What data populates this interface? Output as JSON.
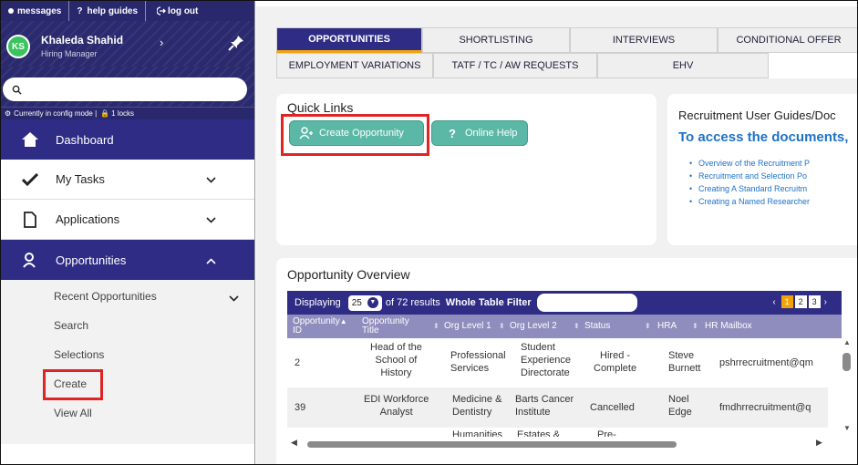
{
  "topbar": {
    "messages": "messages",
    "help": "help guides",
    "logout": "log out"
  },
  "user": {
    "initials": "KS",
    "name": "Khaleda Shahid",
    "role": "Hiring Manager"
  },
  "search": {
    "placeholder": ""
  },
  "config": {
    "text": "Currently in config mode |",
    "locks": "1 locks"
  },
  "nav": {
    "dashboard": "Dashboard",
    "tasks": "My Tasks",
    "applications": "Applications",
    "opportunities": "Opportunities",
    "sub": {
      "recent": "Recent Opportunities",
      "search": "Search",
      "selections": "Selections",
      "create": "Create",
      "view_all": "View All"
    }
  },
  "tabs": {
    "row1": [
      "OPPORTUNITIES",
      "SHORTLISTING",
      "INTERVIEWS",
      "CONDITIONAL OFFER"
    ],
    "row2": [
      "EMPLOYMENT VARIATIONS",
      "TATF / TC / AW REQUESTS",
      "EHV"
    ]
  },
  "quicklinks": {
    "title": "Quick Links",
    "create": "Create Opportunity",
    "help": "Online Help"
  },
  "guides": {
    "title": "Recruitment User Guides/Doc",
    "subtitle": "To access the documents,",
    "items": [
      "Overview of the Recruitment P",
      "Recruitment and Selection Po",
      "Creating A Standard Recruitm",
      "Creating a Named Researcher"
    ]
  },
  "overview": {
    "title": "Opportunity Overview",
    "displaying": "Displaying",
    "page_size": "25",
    "results": "of 72 results",
    "filter_label": "Whole Table Filter",
    "pages": [
      "1",
      "2",
      "3"
    ],
    "columns": {
      "id": [
        "Opportunity",
        "ID"
      ],
      "title": [
        "Opportunity",
        "Title"
      ],
      "org1": "Org Level 1",
      "org2": "Org Level 2",
      "status": "Status",
      "hra": "HRA",
      "mailbox": "HR Mailbox"
    },
    "rows": [
      {
        "id": "2",
        "title": [
          "Head of the",
          "School of",
          "History"
        ],
        "org1": [
          "Professional",
          "Services"
        ],
        "org2": [
          "Student",
          "Experience",
          "Directorate"
        ],
        "status": [
          "Hired -",
          "Complete"
        ],
        "hra": [
          "Steve",
          "Burnett"
        ],
        "mailbox": "pshrrecruitment@qm"
      },
      {
        "id": "39",
        "title": [
          "EDI Workforce",
          "Analyst"
        ],
        "org1": [
          "Medicine &",
          "Dentistry"
        ],
        "org2": [
          "Barts Cancer",
          "Institute"
        ],
        "status": [
          "Cancelled"
        ],
        "hra": [
          "Noel",
          "Edge"
        ],
        "mailbox": "fmdhrrecruitment@q"
      },
      {
        "id": "",
        "title": [
          ""
        ],
        "org1": [
          "Humanities"
        ],
        "org2": [
          "Estates &"
        ],
        "status": [
          "Pre-"
        ],
        "hra": [
          ""
        ],
        "mailbox": ""
      }
    ]
  }
}
